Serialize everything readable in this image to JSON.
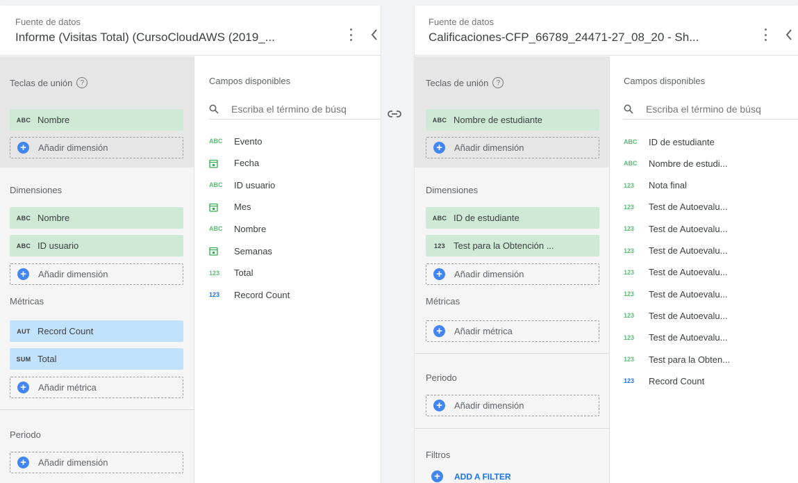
{
  "left": {
    "header_label": "Fuente de datos",
    "source_name": "Informe (Visitas Total) (CursoCloudAWS (2019_...",
    "join_keys_title": "Teclas de unión",
    "join_keys": [
      {
        "type": "ABC",
        "label": "Nombre"
      }
    ],
    "add_dimension_label": "Añadir dimensión",
    "dimensions_title": "Dimensiones",
    "dimensions": [
      {
        "type": "ABC",
        "label": "Nombre"
      },
      {
        "type": "ABC",
        "label": "ID usuario"
      }
    ],
    "metrics_title": "Métricas",
    "metrics": [
      {
        "type": "AUT",
        "label": "Record Count"
      },
      {
        "type": "SUM",
        "label": "Total"
      }
    ],
    "add_metric_label": "Añadir métrica",
    "period_title": "Periodo",
    "fields_title": "Campos disponibles",
    "search_placeholder": "Escriba el término de búsq",
    "fields": [
      {
        "type": "ABC",
        "label": "Evento"
      },
      {
        "type": "cal",
        "label": "Fecha"
      },
      {
        "type": "ABC",
        "label": "ID usuario"
      },
      {
        "type": "cal",
        "label": "Mes"
      },
      {
        "type": "ABC",
        "label": "Nombre"
      },
      {
        "type": "cal",
        "label": "Semanas"
      },
      {
        "type": "123",
        "label": "Total"
      },
      {
        "type": "123",
        "label": "Record Count"
      }
    ]
  },
  "right": {
    "header_label": "Fuente de datos",
    "source_name": "Calificaciones-CFP_66789_24471-27_08_20 - Sh...",
    "join_keys_title": "Teclas de unión",
    "join_keys": [
      {
        "type": "ABC",
        "label": "Nombre de estudiante"
      }
    ],
    "add_dimension_label": "Añadir dimensión",
    "dimensions_title": "Dimensiones",
    "dimensions": [
      {
        "type": "ABC",
        "label": "ID de estudiante"
      },
      {
        "type": "123",
        "label": "Test para la Obtención ..."
      }
    ],
    "metrics_title": "Métricas",
    "add_metric_label": "Añadir métrica",
    "period_title": "Periodo",
    "filters_title": "Filtros",
    "add_filter_label": "ADD A FILTER",
    "fields_title": "Campos disponibles",
    "search_placeholder": "Escriba el término de búsq",
    "fields": [
      {
        "type": "ABC",
        "label": "ID de estudiante"
      },
      {
        "type": "ABC",
        "label": "Nombre de estudi..."
      },
      {
        "type": "123",
        "label": "Nota final"
      },
      {
        "type": "123",
        "label": "Test de Autoevalu..."
      },
      {
        "type": "123",
        "label": "Test de Autoevalu..."
      },
      {
        "type": "123",
        "label": "Test de Autoevalu..."
      },
      {
        "type": "123",
        "label": "Test de Autoevalu..."
      },
      {
        "type": "123",
        "label": "Test de Autoevalu..."
      },
      {
        "type": "123",
        "label": "Test de Autoevalu..."
      },
      {
        "type": "123",
        "label": "Test de Autoevalu..."
      },
      {
        "type": "123",
        "label": "Test para la Obten..."
      },
      {
        "type": "123",
        "label": "Record Count"
      }
    ]
  },
  "join_icon": "link-icon",
  "colors": {
    "dimension_chip": "#ceead6",
    "metric_chip": "#c2e2fb",
    "add_icon": "#4285f4",
    "link": "#1a73e8"
  }
}
